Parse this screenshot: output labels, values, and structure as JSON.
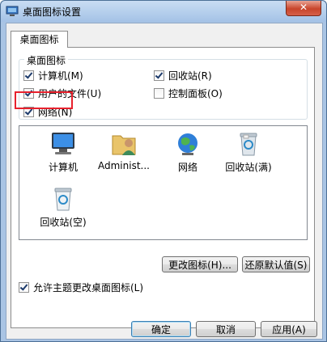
{
  "window": {
    "title": "桌面图标设置",
    "close_glyph": "✕"
  },
  "tabs": [
    {
      "label": "桌面图标"
    }
  ],
  "group": {
    "label": "桌面图标",
    "checkboxes": [
      {
        "label": "计算机(M)",
        "checked": true
      },
      {
        "label": "回收站(R)",
        "checked": true
      },
      {
        "label": "用户的文件(U)",
        "checked": true
      },
      {
        "label": "控制面板(O)",
        "checked": false
      },
      {
        "label": "网络(N)",
        "checked": true
      }
    ]
  },
  "icons": [
    {
      "label": "计算机",
      "icon": "computer-icon"
    },
    {
      "label": "Administ...",
      "icon": "user-folder-icon"
    },
    {
      "label": "网络",
      "icon": "network-globe-icon"
    },
    {
      "label": "回收站(满)",
      "icon": "recycle-bin-full-icon"
    },
    {
      "label": "回收站(空)",
      "icon": "recycle-bin-empty-icon"
    }
  ],
  "buttons": {
    "change_icon": "更改图标(H)...",
    "restore_default": "还原默认值(S)",
    "ok": "确定",
    "cancel": "取消",
    "apply": "应用(A)"
  },
  "allow_themes": {
    "label": "允许主题更改桌面图标(L)",
    "checked": true
  },
  "colors": {
    "highlight": "#e8212d",
    "title_bg": "#a9c4e4",
    "close_button": "#c8452b"
  }
}
